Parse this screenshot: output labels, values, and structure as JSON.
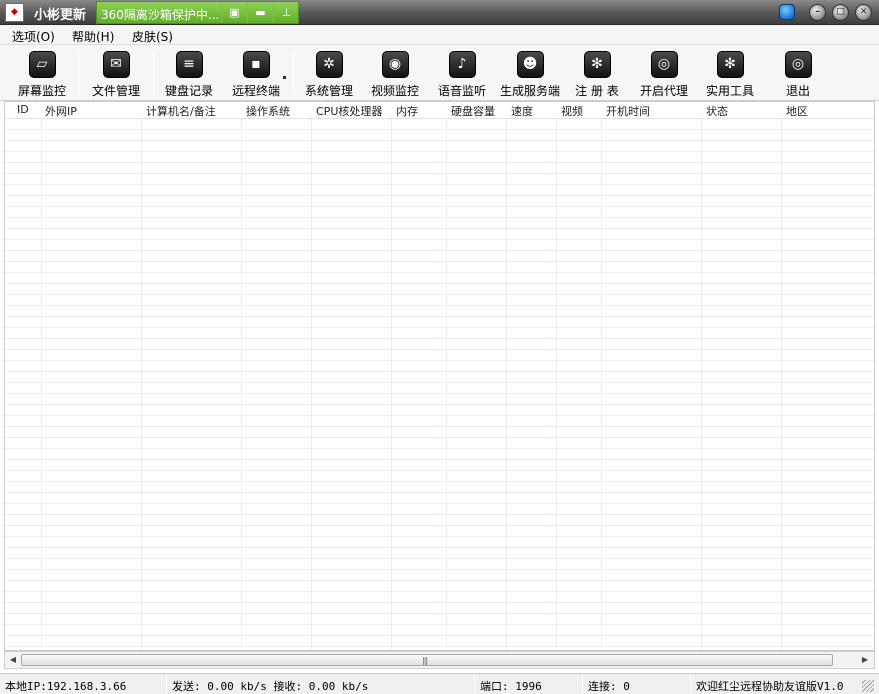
{
  "window": {
    "title": "小彬更新",
    "sandbox_text": "360隔离沙箱保护中..."
  },
  "menu": [
    {
      "label": "选项(O)"
    },
    {
      "label": "帮助(H)"
    },
    {
      "label": "皮肤(S)"
    }
  ],
  "toolbar": [
    {
      "label": "屏幕监控",
      "icon": "screen-icon"
    },
    {
      "label": "文件管理",
      "icon": "mail-icon"
    },
    {
      "label": "键盘记录",
      "icon": "keyboard-icon"
    },
    {
      "label": "远程终端",
      "icon": "terminal-icon"
    },
    {
      "label": "系统管理",
      "icon": "system-icon"
    },
    {
      "label": "视频监控",
      "icon": "camera-icon"
    },
    {
      "label": "语音监听",
      "icon": "microphone-icon"
    },
    {
      "label": "生成服务端",
      "icon": "users-icon"
    },
    {
      "label": "注 册 表",
      "icon": "registry-icon"
    },
    {
      "label": "开启代理",
      "icon": "proxy-icon"
    },
    {
      "label": "实用工具",
      "icon": "tools-icon"
    },
    {
      "label": "退出",
      "icon": "exit-icon"
    }
  ],
  "columns": [
    "ID",
    "外网IP",
    "计算机名/备注",
    "操作系统",
    "CPU核处理器",
    "内存",
    "硬盘容量",
    "速度",
    "视频",
    "开机时间",
    "状态",
    "地区"
  ],
  "status": {
    "local_ip": "本地IP:192.168.3.66",
    "traffic": "发送: 0.00 kb/s 接收: 0.00 kb/s",
    "port": "端口: 1996",
    "connections": "连接: 0",
    "welcome": "欢迎红尘远程协助友谊版V1.0"
  }
}
